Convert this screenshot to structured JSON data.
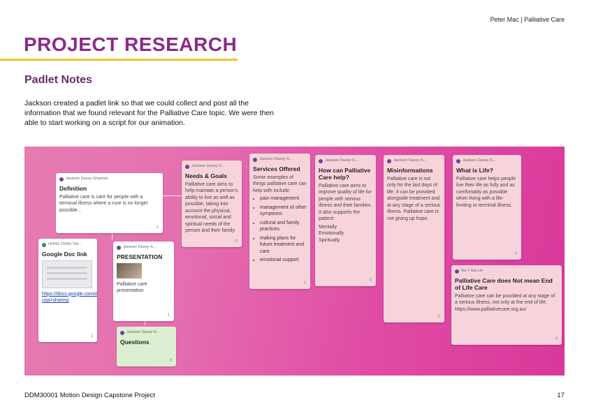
{
  "header": {
    "author_topic": "Peter Mac | Palliative Care"
  },
  "page_title": "PROJECT RESEARCH",
  "section_title": "Padlet Notes",
  "intro_text": "Jackson created a padlet link so that we could collect and post all the information that we found relevant for the Palliative Care topic. We were then able to start working on a script for our animation.",
  "colors": {
    "title": "#8b2a88",
    "accent_underline": "#f2c22e",
    "board_pink": "#e04ca5"
  },
  "padlet": {
    "notes": [
      {
        "id": "definition",
        "author": "Jackson Davey-Shamisli",
        "title": "Definition",
        "body": "Palliative care is care for people with a terminal illness where a cure is no longer possible...",
        "footer": "1"
      },
      {
        "id": "google-doc",
        "author": "HONG TRAN THI...",
        "title": "Google Doc link",
        "body": "https://docs.google.com/document/d/1...edit?usp=sharing",
        "footer": "1"
      },
      {
        "id": "presentation",
        "author": "Jackson Davey-S...",
        "title": "PRESENTATION",
        "body": "Palliative care presentation",
        "footer": "1"
      },
      {
        "id": "questions",
        "author": "Jackson Davey-S...",
        "title": "Questions",
        "body": "",
        "footer": "0"
      },
      {
        "id": "needs",
        "author": "Jackson Davey-S...",
        "title": "Needs & Goals",
        "body": "Palliative care aims to help maintain a person's ability to live as well as possible, taking into account the physical, emotional, social and spiritual needs of the person and their family.",
        "footer": "0"
      },
      {
        "id": "services",
        "author": "Jackson Davey-S...",
        "title": "Services Offered",
        "body": "Some examples of things palliative care can help with include:",
        "list": [
          "pain management",
          "management of other symptoms",
          "cultural and family practices",
          "making plans for future treatment and care",
          "emotional support"
        ],
        "footer": "0"
      },
      {
        "id": "how-help",
        "author": "Jackson Davey-S...",
        "title": "How can Palliative Care help?",
        "body": "Palliative care aims to improve quality of life for people with serious illness and their families. It also supports the patient:",
        "list_plain": [
          "Mentally",
          "Emotionally",
          "Spiritually"
        ],
        "footer": "0"
      },
      {
        "id": "misinformation",
        "author": "Jackson Davey-S...",
        "title": "Misinformations",
        "body": "Palliative care is not only for the last days of life. It can be provided alongside treatment and at any stage of a serious illness. Palliative care is not giving up hope.",
        "footer": "0"
      },
      {
        "id": "what-is",
        "author": "Jackson Davey-S...",
        "title": "What is Life?",
        "body": "Palliative care helps people live their life as fully and as comfortably as possible when living with a life-limiting or terminal illness.",
        "footer": "0"
      },
      {
        "id": "not-only",
        "author": "Na Y Gia Lin",
        "title": "Palliative Care does Not mean End of Life Care",
        "body": "Palliative care can be provided at any stage of a serious illness, not only at the end of life. https://www.palliativecare.org.au/",
        "footer": "0"
      }
    ]
  },
  "footer": {
    "course": "DDM30001 Motion Design Capstone Project",
    "page_number": "17"
  }
}
